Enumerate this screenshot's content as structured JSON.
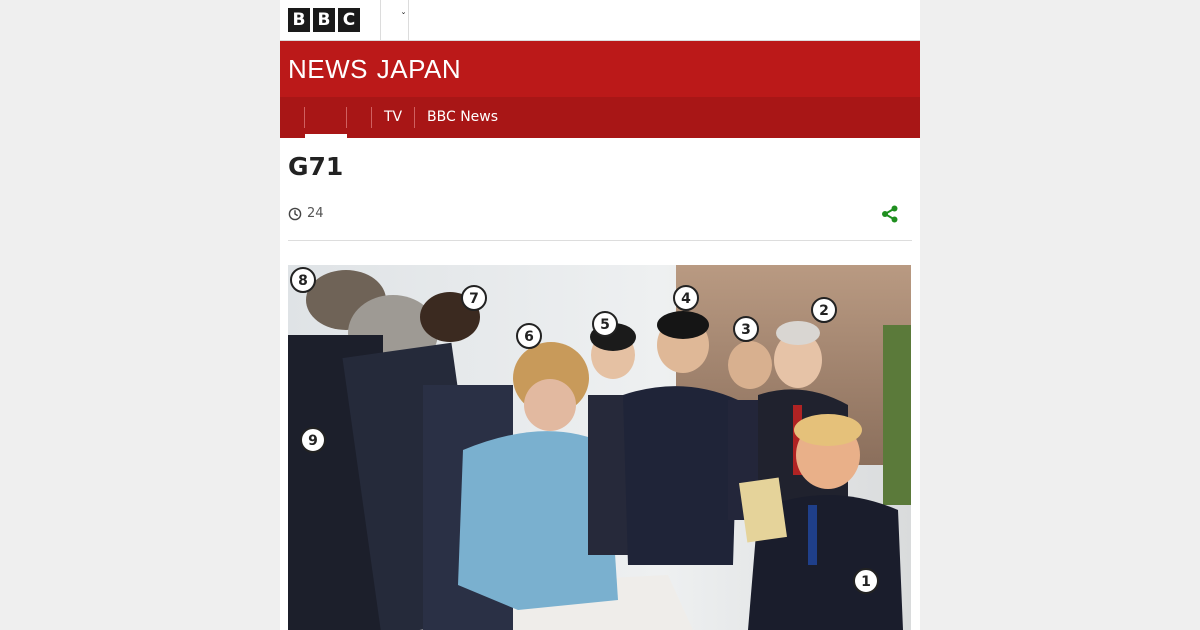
{
  "header": {
    "logo_letters": [
      "B",
      "B",
      "C"
    ],
    "brand_news": "NEWS",
    "brand_region": "JAPAN"
  },
  "nav": {
    "items": [
      {
        "label": ""
      },
      {
        "label": ""
      },
      {
        "label": "TV"
      },
      {
        "label": "BBC News"
      }
    ]
  },
  "article": {
    "title": "G71",
    "timestamp": "24",
    "image_badges": [
      "8",
      "7",
      "6",
      "5",
      "4",
      "3",
      "2",
      "9",
      "1"
    ]
  },
  "colors": {
    "masthead": "#bb1919",
    "nav": "#a81616",
    "share": "#1f8f1f"
  }
}
